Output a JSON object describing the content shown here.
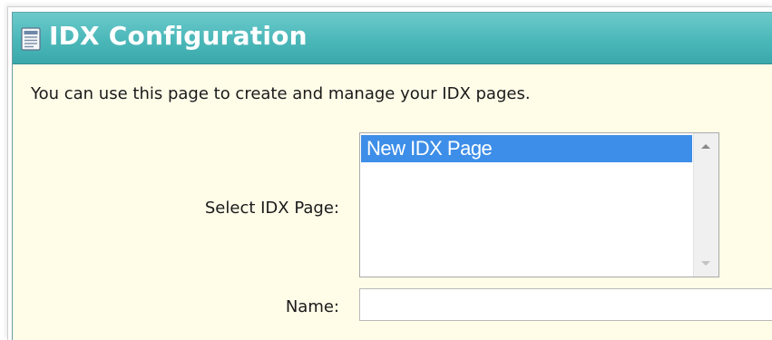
{
  "header": {
    "title": "IDX Configuration",
    "icon": "document-list-icon"
  },
  "intro_text": "You can use this page to create and manage your IDX pages.",
  "select_page": {
    "label": "Select IDX Page:",
    "options": [
      "New IDX Page"
    ],
    "selected": "New IDX Page"
  },
  "name_field": {
    "label": "Name:",
    "value": ""
  },
  "colors": {
    "header_bg": "#4bb7b9",
    "panel_bg": "#fffce8",
    "selection": "#3d8ee8"
  }
}
